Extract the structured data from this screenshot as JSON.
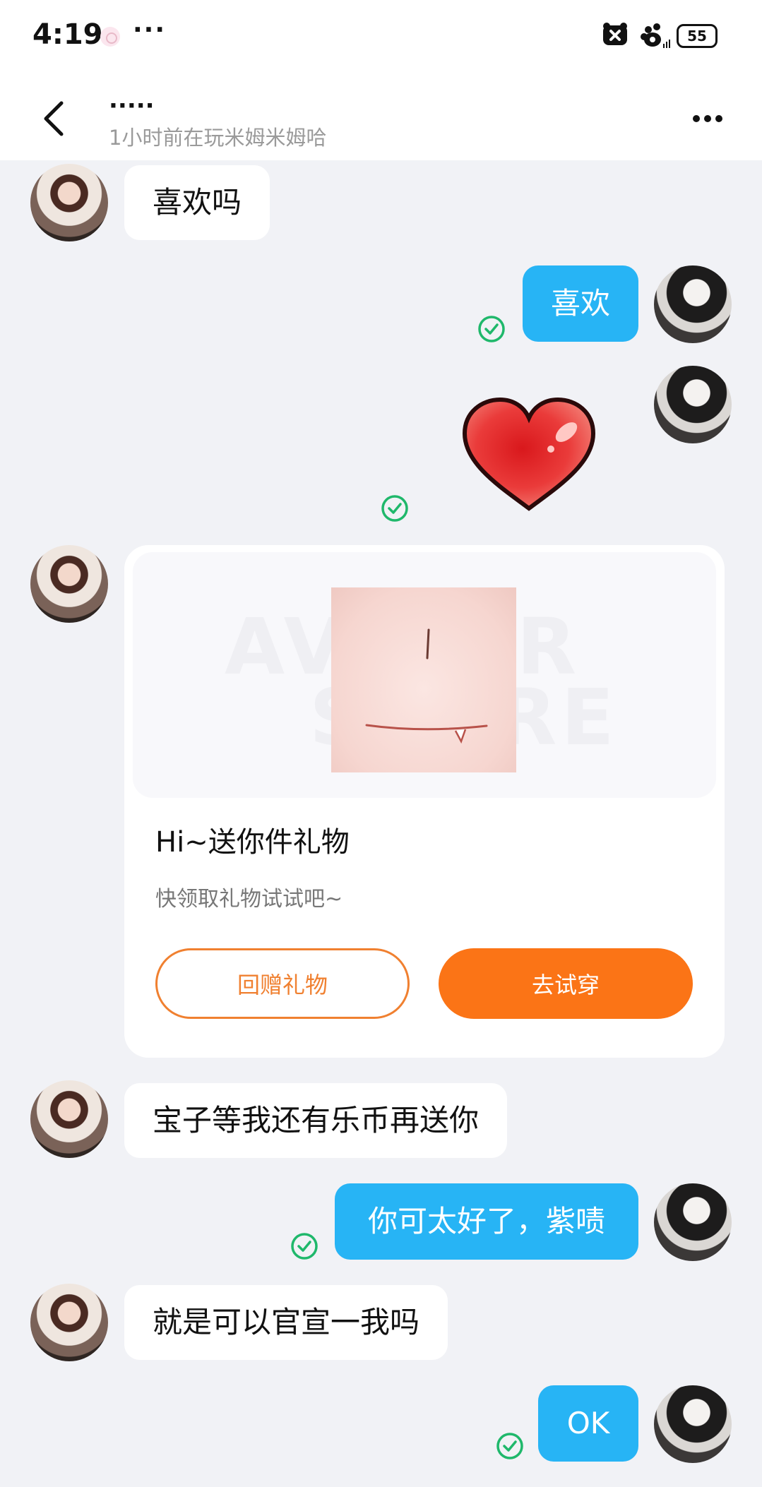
{
  "status_bar": {
    "time": "4:19",
    "more": "···",
    "battery_level": "55"
  },
  "header": {
    "contact_name": "·····",
    "contact_status": "1小时前在玩米姆米姆哈"
  },
  "messages": [
    {
      "side": "in",
      "type": "text",
      "text": "喜欢吗"
    },
    {
      "side": "out",
      "type": "text",
      "text": "喜欢",
      "read": true
    },
    {
      "side": "out",
      "type": "sticker",
      "sticker": "heart-sticker",
      "read": true
    },
    {
      "side": "in",
      "type": "gift_card"
    },
    {
      "side": "in",
      "type": "text",
      "text": "宝子等我还有乐币再送你"
    },
    {
      "side": "out",
      "type": "text",
      "text": "你可太好了，紫啧",
      "read": true
    },
    {
      "side": "in",
      "type": "text",
      "text": "就是可以官宣一我吗"
    },
    {
      "side": "out",
      "type": "text",
      "text": "OK",
      "read": true
    }
  ],
  "gift_card": {
    "title": "Hi~送你件礼物",
    "subtitle": "快领取礼物试试吧~",
    "return_gift_label": "回赠礼物",
    "try_on_label": "去试穿",
    "watermark_line1": "AVATAR",
    "watermark_line2": "STORE"
  },
  "colors": {
    "outgoing_bubble": "#27b4f5",
    "incoming_bubble": "#ffffff",
    "chat_background": "#f1f2f6",
    "read_check": "#1fb86b",
    "accent_orange": "#fb7416"
  }
}
